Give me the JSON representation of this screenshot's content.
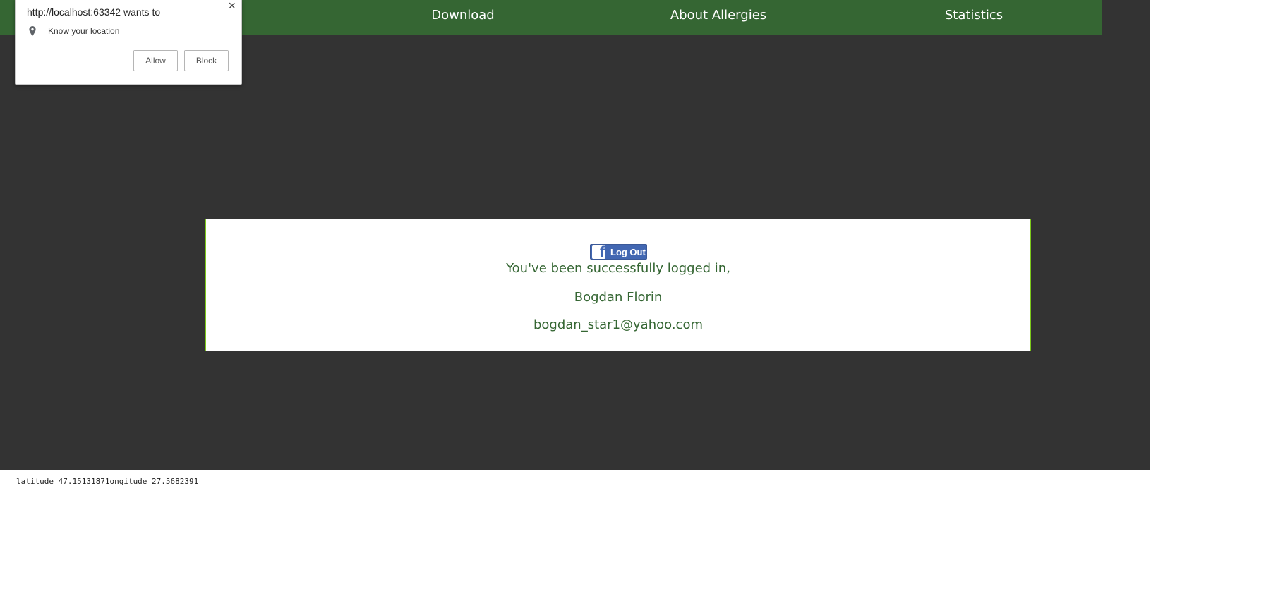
{
  "nav": {
    "items": [
      {
        "label": "Download"
      },
      {
        "label": "About Allergies"
      },
      {
        "label": "Statistics"
      }
    ]
  },
  "login_box": {
    "fb_button_label": "Log Out",
    "fb_logo_glyph": "f",
    "message": "You've been successfully logged in,",
    "user_name": "Bogdan Florin",
    "user_email": "bogdan_star1@yahoo.com"
  },
  "location": {
    "text": "latitude 47.15131871ongitude 27.5682391"
  },
  "permission_popup": {
    "title": "http://localhost:63342 wants to",
    "permission": "Know your location",
    "allow_label": "Allow",
    "block_label": "Block",
    "close_glyph": "×"
  },
  "colors": {
    "nav_bg": "#356633",
    "page_bg": "#333333",
    "box_border": "#7cc81b",
    "text_green": "#356633",
    "fb_blue": "#4267b2"
  },
  "icons": [
    "facebook-icon",
    "location-pin-icon",
    "close-icon"
  ]
}
